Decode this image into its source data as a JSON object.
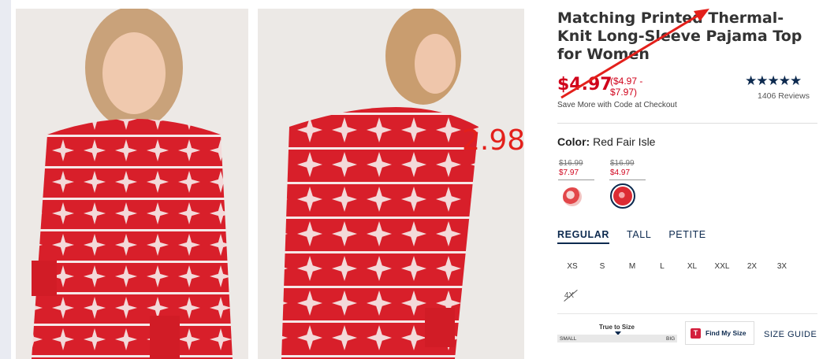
{
  "product": {
    "title": "Matching Printed Thermal-Knit Long-Sleeve Pajama Top for Women",
    "sale_price": "$4.97",
    "price_range": "($4.97 - $7.97)",
    "promo_text": "Save More with Code at Checkout",
    "stars": "★★★★★",
    "reviews": "1406 Reviews"
  },
  "annotation": {
    "price_note": "2.98",
    "color": "#e3201b"
  },
  "color_selector": {
    "label": "Color:",
    "selected": "Red Fair Isle",
    "swatches": [
      {
        "old_price": "$16.99",
        "new_price": "$7.97"
      },
      {
        "old_price": "$16.99",
        "new_price": "$4.97"
      }
    ]
  },
  "fit_tabs": [
    "REGULAR",
    "TALL",
    "PETITE"
  ],
  "sizes": [
    "XS",
    "S",
    "M",
    "L",
    "XL",
    "XXL",
    "2X",
    "3X"
  ],
  "unavailable_size": "4X",
  "fit_scale": {
    "label": "True to Size",
    "small": "SMALL",
    "big": "BIG"
  },
  "find_my_size": {
    "icon_letter": "T",
    "label": "Find My Size"
  },
  "size_guide": "SIZE GUIDE",
  "colors": {
    "sale_red": "#d0021b",
    "navy": "#0d2a4f"
  }
}
